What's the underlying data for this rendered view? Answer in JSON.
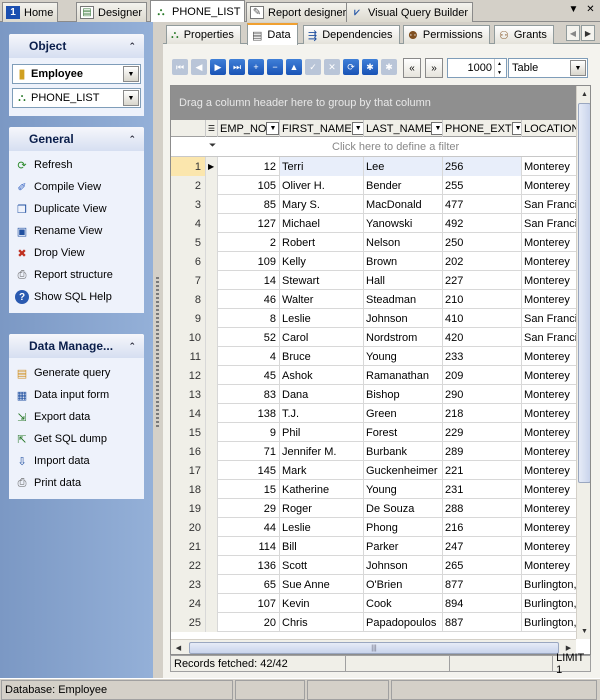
{
  "window_tabs": [
    {
      "label": "Home",
      "icon": "home-icon",
      "active": false
    },
    {
      "label": "Designer",
      "icon": "designer-icon",
      "active": false
    },
    {
      "label": "PHONE_LIST",
      "icon": "view-icon",
      "active": true
    },
    {
      "label": "Report designer",
      "icon": "report-icon",
      "active": false
    },
    {
      "label": "Visual Query Builder",
      "icon": "query-builder-icon",
      "active": false
    }
  ],
  "window_controls": {
    "menu": "▼",
    "close": "✕"
  },
  "left": {
    "object_panel": {
      "title": "Object",
      "database": "Employee",
      "view": "PHONE_LIST"
    },
    "general_panel": {
      "title": "General",
      "items": [
        {
          "label": "Refresh",
          "icon": "refresh-icon"
        },
        {
          "label": "Compile View",
          "icon": "compile-icon"
        },
        {
          "label": "Duplicate View",
          "icon": "duplicate-icon"
        },
        {
          "label": "Rename View",
          "icon": "rename-icon"
        },
        {
          "label": "Drop View",
          "icon": "drop-icon"
        },
        {
          "label": "Report structure",
          "icon": "printer-icon"
        },
        {
          "label": "Show SQL Help",
          "icon": "help-icon"
        }
      ]
    },
    "data_panel": {
      "title": "Data Manage...",
      "items": [
        {
          "label": "Generate query",
          "icon": "generate-query-icon"
        },
        {
          "label": "Data input form",
          "icon": "form-icon"
        },
        {
          "label": "Export data",
          "icon": "export-icon"
        },
        {
          "label": "Get SQL dump",
          "icon": "sql-dump-icon"
        },
        {
          "label": "Import data",
          "icon": "import-icon"
        },
        {
          "label": "Print data",
          "icon": "printer-icon"
        }
      ]
    }
  },
  "sub_tabs": [
    {
      "label": "Properties",
      "icon": "properties-icon",
      "active": false
    },
    {
      "label": "Data",
      "icon": "data-icon",
      "active": true
    },
    {
      "label": "Dependencies",
      "icon": "dependencies-icon",
      "active": false
    },
    {
      "label": "Permissions",
      "icon": "permissions-icon",
      "active": false
    },
    {
      "label": "Grants",
      "icon": "grants-icon",
      "active": false
    }
  ],
  "toolbar": {
    "record_limit": "1000",
    "view_mode": "Table"
  },
  "grid": {
    "group_hint": "Drag a column header here to group by that column",
    "filter_hint": "Click here to define a filter",
    "columns": [
      "EMP_NO",
      "FIRST_NAME",
      "LAST_NAME",
      "PHONE_EXT",
      "LOCATION"
    ],
    "selected_row": 1,
    "rows": [
      [
        "1",
        "12",
        "Terri",
        "Lee",
        "256",
        "Monterey"
      ],
      [
        "2",
        "105",
        "Oliver H.",
        "Bender",
        "255",
        "Monterey"
      ],
      [
        "3",
        "85",
        "Mary S.",
        "MacDonald",
        "477",
        "San Franci"
      ],
      [
        "4",
        "127",
        "Michael",
        "Yanowski",
        "492",
        "San Franci"
      ],
      [
        "5",
        "2",
        "Robert",
        "Nelson",
        "250",
        "Monterey"
      ],
      [
        "6",
        "109",
        "Kelly",
        "Brown",
        "202",
        "Monterey"
      ],
      [
        "7",
        "14",
        "Stewart",
        "Hall",
        "227",
        "Monterey"
      ],
      [
        "8",
        "46",
        "Walter",
        "Steadman",
        "210",
        "Monterey"
      ],
      [
        "9",
        "8",
        "Leslie",
        "Johnson",
        "410",
        "San Franci"
      ],
      [
        "10",
        "52",
        "Carol",
        "Nordstrom",
        "420",
        "San Franci"
      ],
      [
        "11",
        "4",
        "Bruce",
        "Young",
        "233",
        "Monterey"
      ],
      [
        "12",
        "45",
        "Ashok",
        "Ramanathan",
        "209",
        "Monterey"
      ],
      [
        "13",
        "83",
        "Dana",
        "Bishop",
        "290",
        "Monterey"
      ],
      [
        "14",
        "138",
        "T.J.",
        "Green",
        "218",
        "Monterey"
      ],
      [
        "15",
        "9",
        "Phil",
        "Forest",
        "229",
        "Monterey"
      ],
      [
        "16",
        "71",
        "Jennifer M.",
        "Burbank",
        "289",
        "Monterey"
      ],
      [
        "17",
        "145",
        "Mark",
        "Guckenheimer",
        "221",
        "Monterey"
      ],
      [
        "18",
        "15",
        "Katherine",
        "Young",
        "231",
        "Monterey"
      ],
      [
        "19",
        "29",
        "Roger",
        "De Souza",
        "288",
        "Monterey"
      ],
      [
        "20",
        "44",
        "Leslie",
        "Phong",
        "216",
        "Monterey"
      ],
      [
        "21",
        "114",
        "Bill",
        "Parker",
        "247",
        "Monterey"
      ],
      [
        "22",
        "136",
        "Scott",
        "Johnson",
        "265",
        "Monterey"
      ],
      [
        "23",
        "65",
        "Sue Anne",
        "O'Brien",
        "877",
        "Burlington,"
      ],
      [
        "24",
        "107",
        "Kevin",
        "Cook",
        "894",
        "Burlington,"
      ],
      [
        "25",
        "20",
        "Chris",
        "Papadopoulos",
        "887",
        "Burlington,"
      ]
    ]
  },
  "grid_status": {
    "records": "Records fetched: 42/42",
    "limit": "LIMIT 1"
  },
  "status_bar": {
    "database": "Database: Employee"
  }
}
